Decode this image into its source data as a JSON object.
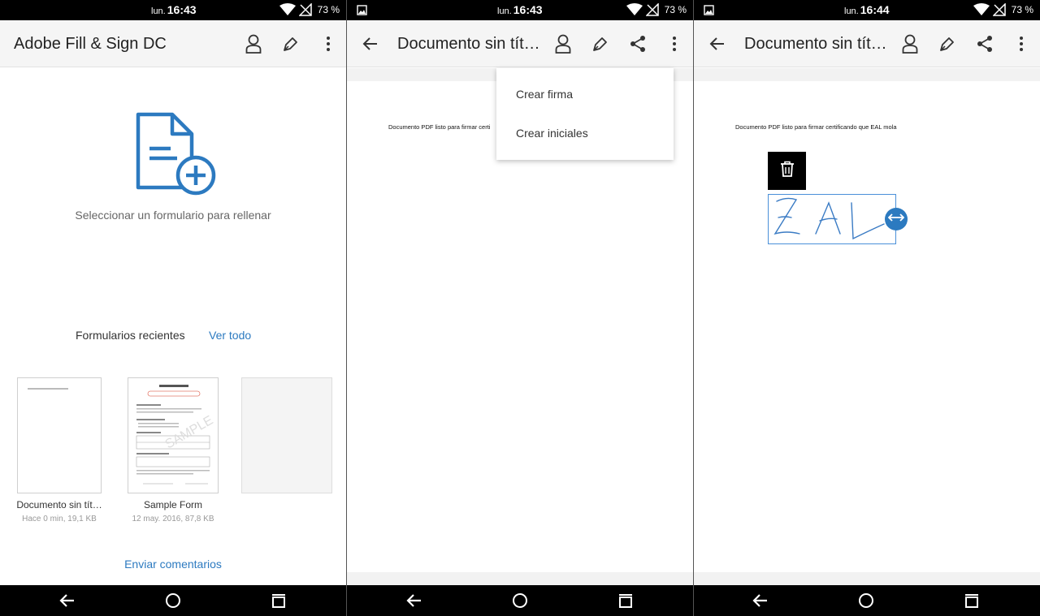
{
  "status": [
    {
      "day": "lun.",
      "time": "16:43",
      "battery": "73 %"
    },
    {
      "day": "lun.",
      "time": "16:43",
      "battery": "73 %"
    },
    {
      "day": "lun.",
      "time": "16:44",
      "battery": "73 %"
    }
  ],
  "pane1": {
    "title": "Adobe Fill & Sign DC",
    "empty_text": "Seleccionar un formulario para rellenar",
    "recent_title": "Formularios recientes",
    "see_all": "Ver todo",
    "recent": [
      {
        "name": "Documento sin tít…",
        "meta": "Hace 0 min, 19,1 KB"
      },
      {
        "name": "Sample Form",
        "meta": "12 may. 2016, 87,8 KB"
      },
      {
        "name": "",
        "meta": ""
      }
    ],
    "feedback": "Enviar comentarios"
  },
  "pane2": {
    "title": "Documento sin tít…",
    "doc_text": "Documento PDF listo para firmar certi",
    "menu": [
      "Crear firma",
      "Crear iniciales"
    ]
  },
  "pane3": {
    "title": "Documento sin tít…",
    "doc_text": "Documento PDF listo para firmar certificando que EAL mola",
    "signature_text": "EAL"
  },
  "icons": {
    "profile": "person-icon",
    "sign": "pen-icon",
    "share": "share-icon",
    "more": "more-vert-icon",
    "back": "arrow-back-icon"
  },
  "colors": {
    "accent": "#2c7ac0",
    "ink": "#3a7bc4"
  }
}
